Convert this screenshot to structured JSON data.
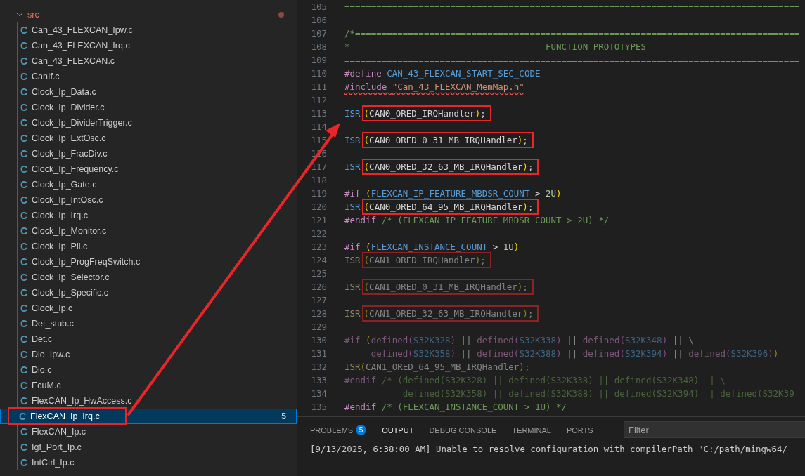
{
  "sidebar": {
    "items": [
      {
        "kind": "folder",
        "label": "src",
        "expanded": true,
        "modified": true
      }
    ],
    "files": [
      {
        "icon": "C",
        "kind": "source",
        "label": "Can_43_FLEXCAN_Ipw.c",
        "selected": false,
        "annotated": false
      },
      {
        "icon": "C",
        "kind": "source",
        "label": "Can_43_FLEXCAN_Irq.c",
        "selected": false,
        "annotated": false
      },
      {
        "icon": "C",
        "kind": "source",
        "label": "Can_43_FLEXCAN.c",
        "selected": false,
        "annotated": false
      },
      {
        "icon": "C",
        "kind": "source",
        "label": "CanIf.c",
        "selected": false,
        "annotated": false
      },
      {
        "icon": "C",
        "kind": "source",
        "label": "Clock_Ip_Data.c",
        "selected": false,
        "annotated": false
      },
      {
        "icon": "C",
        "kind": "source",
        "label": "Clock_Ip_Divider.c",
        "selected": false,
        "annotated": false
      },
      {
        "icon": "C",
        "kind": "source",
        "label": "Clock_Ip_DividerTrigger.c",
        "selected": false,
        "annotated": false
      },
      {
        "icon": "C",
        "kind": "source",
        "label": "Clock_Ip_ExtOsc.c",
        "selected": false,
        "annotated": false
      },
      {
        "icon": "C",
        "kind": "source",
        "label": "Clock_Ip_FracDiv.c",
        "selected": false,
        "annotated": false
      },
      {
        "icon": "C",
        "kind": "source",
        "label": "Clock_Ip_Frequency.c",
        "selected": false,
        "annotated": false
      },
      {
        "icon": "C",
        "kind": "source",
        "label": "Clock_Ip_Gate.c",
        "selected": false,
        "annotated": false
      },
      {
        "icon": "C",
        "kind": "source",
        "label": "Clock_Ip_IntOsc.c",
        "selected": false,
        "annotated": false
      },
      {
        "icon": "C",
        "kind": "source",
        "label": "Clock_Ip_Irq.c",
        "selected": false,
        "annotated": false
      },
      {
        "icon": "C",
        "kind": "source",
        "label": "Clock_Ip_Monitor.c",
        "selected": false,
        "annotated": false
      },
      {
        "icon": "C",
        "kind": "source",
        "label": "Clock_Ip_Pll.c",
        "selected": false,
        "annotated": false
      },
      {
        "icon": "C",
        "kind": "source",
        "label": "Clock_Ip_ProgFreqSwitch.c",
        "selected": false,
        "annotated": false
      },
      {
        "icon": "C",
        "kind": "source",
        "label": "Clock_Ip_Selector.c",
        "selected": false,
        "annotated": false
      },
      {
        "icon": "C",
        "kind": "source",
        "label": "Clock_Ip_Specific.c",
        "selected": false,
        "annotated": false
      },
      {
        "icon": "C",
        "kind": "source",
        "label": "Clock_Ip.c",
        "selected": false,
        "annotated": false
      },
      {
        "icon": "C",
        "kind": "source",
        "label": "Det_stub.c",
        "selected": false,
        "annotated": false
      },
      {
        "icon": "C",
        "kind": "source",
        "label": "Det.c",
        "selected": false,
        "annotated": false
      },
      {
        "icon": "C",
        "kind": "source",
        "label": "Dio_Ipw.c",
        "selected": false,
        "annotated": false
      },
      {
        "icon": "C",
        "kind": "source",
        "label": "Dio.c",
        "selected": false,
        "annotated": false
      },
      {
        "icon": "C",
        "kind": "source",
        "label": "EcuM.c",
        "selected": false,
        "annotated": false
      },
      {
        "icon": "C",
        "kind": "source",
        "label": "FlexCAN_Ip_HwAccess.c",
        "selected": false,
        "annotated": false
      },
      {
        "icon": "C",
        "kind": "source",
        "label": "FlexCAN_Ip_Irq.c",
        "selected": true,
        "annotated": true,
        "badge": "5"
      },
      {
        "icon": "C",
        "kind": "source",
        "label": "FlexCAN_Ip.c",
        "selected": false,
        "annotated": false
      },
      {
        "icon": "C",
        "kind": "source",
        "label": "Igf_Port_Ip.c",
        "selected": false,
        "annotated": false
      },
      {
        "icon": "C",
        "kind": "source",
        "label": "IntCtrl_Ip.c",
        "selected": false,
        "annotated": false
      }
    ]
  },
  "editor": {
    "lines": [
      {
        "number": "105",
        "inactive": false,
        "tokens": [
          {
            "text": "======================================================================================",
            "kind": "comment"
          }
        ]
      },
      {
        "number": "106"
      },
      {
        "number": "107",
        "inactive": false,
        "tokens": [
          {
            "text": "/*====================================================================================",
            "kind": "comment"
          }
        ]
      },
      {
        "number": "108",
        "inactive": false,
        "tokens": [
          {
            "text": "*                                     FUNCTION PROTOTYPES",
            "kind": "comment"
          }
        ]
      },
      {
        "number": "109",
        "inactive": false,
        "tokens": [
          {
            "text": "======================================================================================",
            "kind": "comment"
          }
        ]
      },
      {
        "number": "110",
        "inactive": false,
        "tokens": [
          {
            "text": "#define ",
            "kind": "directive"
          },
          {
            "text": "CAN_43_FLEXCAN_START_SEC_CODE",
            "kind": "macro"
          }
        ]
      },
      {
        "number": "111",
        "inactive": false,
        "error": true,
        "tokens": [
          {
            "text": "#include ",
            "kind": "directive"
          },
          {
            "text": "\"Can_43_FLEXCAN_MemMap.h\"",
            "kind": "string"
          }
        ]
      },
      {
        "number": "112"
      },
      {
        "number": "113",
        "inactive": false,
        "tokens": [
          {
            "text": "ISR",
            "kind": "macro"
          },
          {
            "kind": "annotation-box",
            "tokens": [
              {
                "text": "(",
                "kind": "paren"
              },
              {
                "text": "CAN0_ORED_IRQHandler",
                "kind": "plain"
              },
              {
                "text": ")",
                "kind": "paren"
              },
              {
                "text": ";",
                "kind": "plain"
              }
            ]
          }
        ]
      },
      {
        "number": "114"
      },
      {
        "number": "115",
        "inactive": false,
        "tokens": [
          {
            "text": "ISR",
            "kind": "macro"
          },
          {
            "kind": "annotation-box",
            "tokens": [
              {
                "text": "(",
                "kind": "paren"
              },
              {
                "text": "CAN0_ORED_0_31_MB_IRQHandler",
                "kind": "plain"
              },
              {
                "text": ")",
                "kind": "paren"
              },
              {
                "text": ";",
                "kind": "plain"
              }
            ]
          }
        ]
      },
      {
        "number": "116"
      },
      {
        "number": "117",
        "inactive": false,
        "tokens": [
          {
            "text": "ISR",
            "kind": "macro"
          },
          {
            "kind": "annotation-box",
            "tokens": [
              {
                "text": "(",
                "kind": "paren"
              },
              {
                "text": "CAN0_ORED_32_63_MB_IRQHandler",
                "kind": "plain"
              },
              {
                "text": ")",
                "kind": "paren"
              },
              {
                "text": ";",
                "kind": "plain"
              }
            ]
          }
        ]
      },
      {
        "number": "118"
      },
      {
        "number": "119",
        "inactive": false,
        "tokens": [
          {
            "text": "#if ",
            "kind": "directive"
          },
          {
            "text": "(",
            "kind": "paren"
          },
          {
            "text": "FLEXCAN_IP_FEATURE_MBDSR_COUNT",
            "kind": "macro"
          },
          {
            "text": " > ",
            "kind": "plain"
          },
          {
            "text": "2U",
            "kind": "number"
          },
          {
            "text": ")",
            "kind": "paren"
          }
        ]
      },
      {
        "number": "120",
        "inactive": false,
        "tokens": [
          {
            "text": "ISR",
            "kind": "macro"
          },
          {
            "kind": "annotation-box",
            "tokens": [
              {
                "text": "(",
                "kind": "paren"
              },
              {
                "text": "CAN0_ORED_64_95_MB_IRQHandler",
                "kind": "plain"
              },
              {
                "text": ")",
                "kind": "paren"
              },
              {
                "text": ";",
                "kind": "plain"
              }
            ]
          }
        ]
      },
      {
        "number": "121",
        "inactive": false,
        "tokens": [
          {
            "text": "#endif",
            "kind": "directive"
          },
          {
            "text": " /* (FLEXCAN_IP_FEATURE_MBDSR_COUNT > 2U) */",
            "kind": "comment"
          }
        ]
      },
      {
        "number": "122"
      },
      {
        "number": "123",
        "inactive": false,
        "tokens": [
          {
            "text": "#if ",
            "kind": "directive"
          },
          {
            "text": "(",
            "kind": "paren"
          },
          {
            "text": "FLEXCAN_INSTANCE_COUNT",
            "kind": "macro"
          },
          {
            "text": " > ",
            "kind": "plain"
          },
          {
            "text": "1U",
            "kind": "number"
          },
          {
            "text": ")",
            "kind": "paren"
          }
        ]
      },
      {
        "number": "124",
        "inactive": true,
        "tokens": [
          {
            "text": "ISR",
            "kind": "func"
          },
          {
            "kind": "annotation-box",
            "tokens": [
              {
                "text": "(",
                "kind": "paren"
              },
              {
                "text": "CAN1_ORED_IRQHandler",
                "kind": "plain"
              },
              {
                "text": ")",
                "kind": "paren"
              },
              {
                "text": ";",
                "kind": "plain"
              }
            ]
          }
        ]
      },
      {
        "number": "125"
      },
      {
        "number": "126",
        "inactive": true,
        "tokens": [
          {
            "text": "ISR",
            "kind": "func"
          },
          {
            "kind": "annotation-box",
            "tokens": [
              {
                "text": "(",
                "kind": "paren"
              },
              {
                "text": "CAN1_ORED_0_31_MB_IRQHandler",
                "kind": "plain"
              },
              {
                "text": ")",
                "kind": "paren"
              },
              {
                "text": ";",
                "kind": "plain"
              }
            ]
          }
        ]
      },
      {
        "number": "127"
      },
      {
        "number": "128",
        "inactive": true,
        "tokens": [
          {
            "text": "ISR",
            "kind": "func"
          },
          {
            "kind": "annotation-box",
            "tokens": [
              {
                "text": "(",
                "kind": "paren"
              },
              {
                "text": "CAN1_ORED_32_63_MB_IRQHandler",
                "kind": "plain"
              },
              {
                "text": ")",
                "kind": "paren"
              },
              {
                "text": ";",
                "kind": "plain"
              }
            ]
          }
        ]
      },
      {
        "number": "129"
      },
      {
        "number": "130",
        "inactive": true,
        "tokens": [
          {
            "text": "#if ",
            "kind": "directive"
          },
          {
            "text": "(",
            "kind": "paren"
          },
          {
            "text": "defined",
            "kind": "directive"
          },
          {
            "text": "(",
            "kind": "paren2"
          },
          {
            "text": "S32K328",
            "kind": "macro"
          },
          {
            "text": ")",
            "kind": "paren2"
          },
          {
            "text": " || ",
            "kind": "plain"
          },
          {
            "text": "defined",
            "kind": "directive"
          },
          {
            "text": "(",
            "kind": "paren2"
          },
          {
            "text": "S32K338",
            "kind": "macro"
          },
          {
            "text": ")",
            "kind": "paren2"
          },
          {
            "text": " || ",
            "kind": "plain"
          },
          {
            "text": "defined",
            "kind": "directive"
          },
          {
            "text": "(",
            "kind": "paren2"
          },
          {
            "text": "S32K348",
            "kind": "macro"
          },
          {
            "text": ")",
            "kind": "paren2"
          },
          {
            "text": " || \\",
            "kind": "plain"
          }
        ]
      },
      {
        "number": "131",
        "inactive": true,
        "tokens": [
          {
            "text": "     defined",
            "kind": "directive"
          },
          {
            "text": "(",
            "kind": "paren2"
          },
          {
            "text": "S32K358",
            "kind": "macro"
          },
          {
            "text": ")",
            "kind": "paren2"
          },
          {
            "text": " || ",
            "kind": "plain"
          },
          {
            "text": "defined",
            "kind": "directive"
          },
          {
            "text": "(",
            "kind": "paren2"
          },
          {
            "text": "S32K388",
            "kind": "macro"
          },
          {
            "text": ")",
            "kind": "paren2"
          },
          {
            "text": " || ",
            "kind": "plain"
          },
          {
            "text": "defined",
            "kind": "directive"
          },
          {
            "text": "(",
            "kind": "paren2"
          },
          {
            "text": "S32K394",
            "kind": "macro"
          },
          {
            "text": ")",
            "kind": "paren2"
          },
          {
            "text": " || ",
            "kind": "plain"
          },
          {
            "text": "defined",
            "kind": "directive"
          },
          {
            "text": "(",
            "kind": "paren2"
          },
          {
            "text": "S32K396",
            "kind": "macro"
          },
          {
            "text": ")",
            "kind": "paren2"
          },
          {
            "text": ")",
            "kind": "paren"
          }
        ]
      },
      {
        "number": "132",
        "inactive": true,
        "tokens": [
          {
            "text": "ISR",
            "kind": "func"
          },
          {
            "text": "(",
            "kind": "paren"
          },
          {
            "text": "CAN1_ORED_64_95_MB_IRQHandler",
            "kind": "plain"
          },
          {
            "text": ")",
            "kind": "paren"
          },
          {
            "text": ";",
            "kind": "plain"
          }
        ]
      },
      {
        "number": "133",
        "inactive": true,
        "tokens": [
          {
            "text": "#endif",
            "kind": "directive"
          },
          {
            "text": " /* (defined(S32K328) || defined(S32K338) || defined(S32K348) || \\",
            "kind": "comment"
          }
        ]
      },
      {
        "number": "134",
        "inactive": true,
        "tokens": [
          {
            "text": "           defined(S32K358) || defined(S32K388) || defined(S32K394) || defined(S32K39",
            "kind": "comment"
          }
        ]
      },
      {
        "number": "135",
        "inactive": false,
        "tokens": [
          {
            "text": "#endif",
            "kind": "directive"
          },
          {
            "text": " /* (FLEXCAN_INSTANCE_COUNT > 1U) */",
            "kind": "comment"
          }
        ]
      }
    ]
  },
  "panel": {
    "tabs": [
      {
        "label": "PROBLEMS",
        "badge": "5",
        "selected": false
      },
      {
        "label": "OUTPUT",
        "selected": true
      },
      {
        "label": "DEBUG CONSOLE",
        "selected": false
      },
      {
        "label": "TERMINAL",
        "selected": false
      },
      {
        "label": "PORTS",
        "selected": false
      }
    ],
    "filter": {
      "placeholder": "Filter"
    },
    "output": [
      "[9/13/2025, 6:38:00 AM] Unable to resolve configuration with compilerPath \"C:/path/mingw64/"
    ]
  },
  "annotation": {
    "kind": "arrow"
  }
}
